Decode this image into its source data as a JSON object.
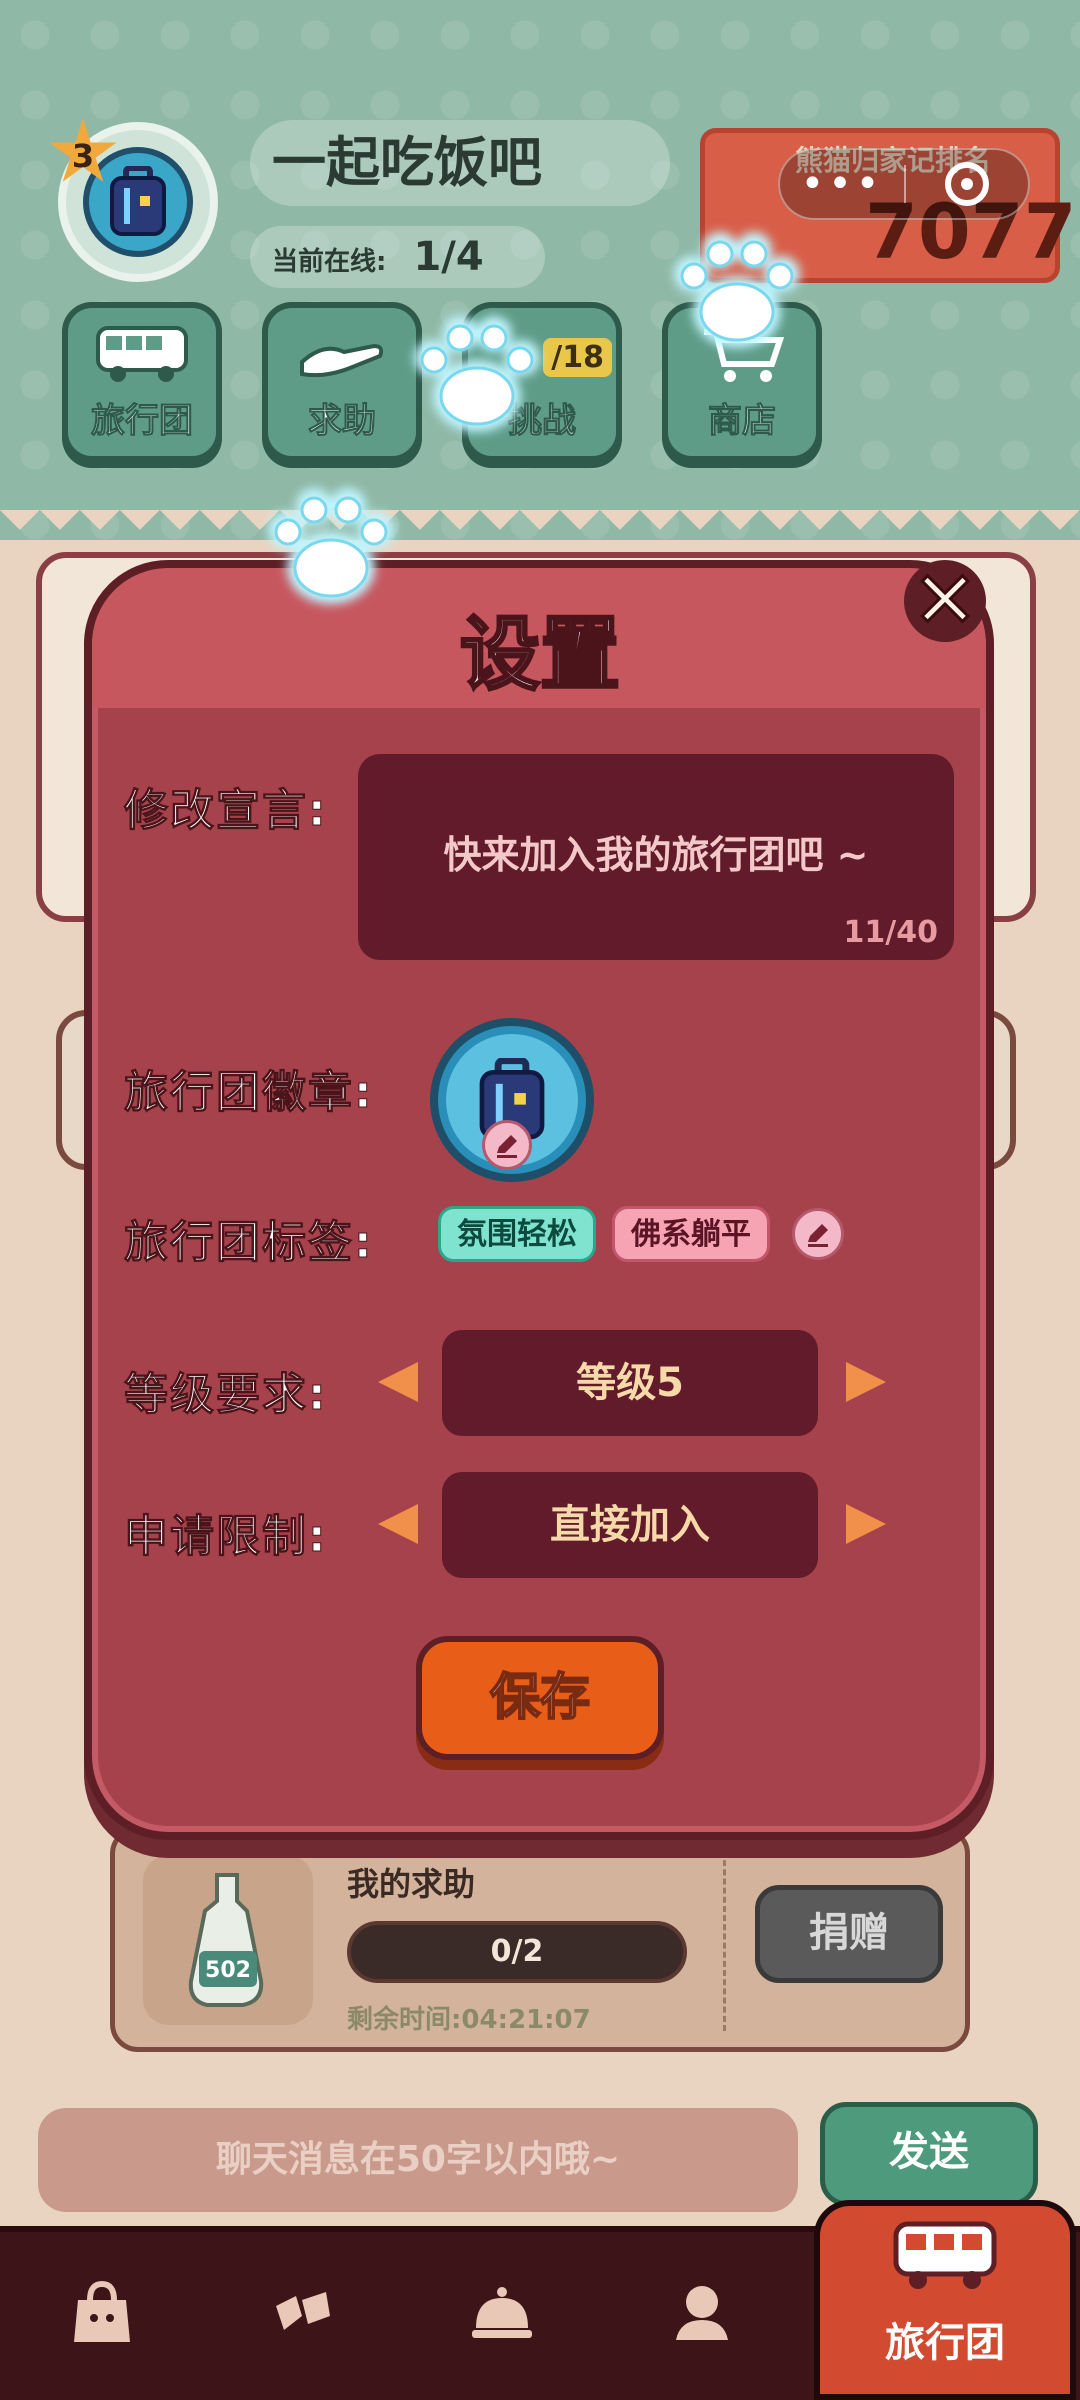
{
  "header": {
    "level": "3",
    "team_name": "一起吃饭吧",
    "online_label": "当前在线:",
    "online_count": "1/4",
    "rank_title": "熊猫归家记排名",
    "rank_value": "7077"
  },
  "menu": {
    "tour": "旅行团",
    "help": "求助",
    "battle": "挑战",
    "battle_badge": "/18",
    "shop": "商店"
  },
  "settings": {
    "title": "设置",
    "close": "✕",
    "slogan_label": "修改宣言:",
    "slogan_value": "快来加入我的旅行团吧 ~",
    "slogan_count": "11/40",
    "emblem_label": "旅行团徽章:",
    "tags_label": "旅行团标签:",
    "tags": [
      "氛围轻松",
      "佛系躺平"
    ],
    "level_label": "等级要求:",
    "level_value": "等级5",
    "apply_label": "申请限制:",
    "apply_value": "直接加入",
    "save": "保存"
  },
  "help_card": {
    "title": "我的求助",
    "progress": "0/2",
    "time_left": "剩余时间:04:21:07",
    "donate": "捐赠",
    "item_label": "502"
  },
  "chat": {
    "placeholder": "聊天消息在50字以内哦~",
    "send": "发送"
  },
  "bottom_nav": {
    "active_label": "旅行团"
  },
  "colors": {
    "dialog": "#a6424b",
    "dialog_border": "#5e1e25",
    "field": "#611b2b",
    "save": "#e85e18",
    "tag_teal": "#7fe3d0",
    "tag_pink": "#f6a3b4"
  }
}
